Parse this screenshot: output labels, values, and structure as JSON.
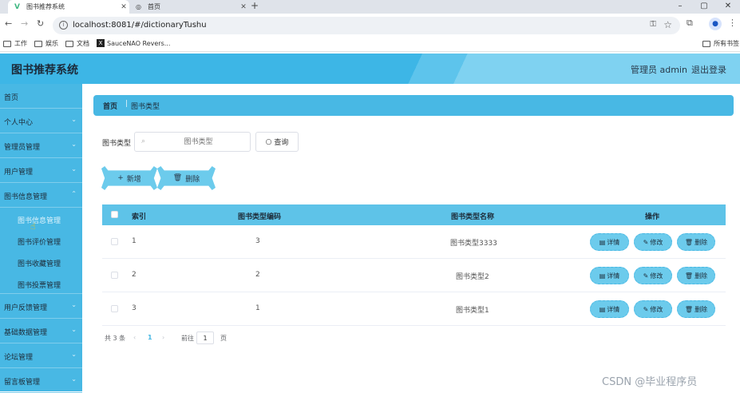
{
  "browser": {
    "tabs": [
      {
        "title": "图书推荐系统",
        "close": "✕"
      },
      {
        "title": "首页",
        "close": "✕"
      }
    ],
    "new_tab": "+",
    "url": "localhost:8081/#/dictionaryTushu",
    "bookmarks": [
      "工作",
      "娱乐",
      "文档",
      "SauceNAO Revers..."
    ],
    "bookmarks_right": "所有书签"
  },
  "header": {
    "title": "图书推荐系统",
    "admin_label": "管理员 admin",
    "logout": "退出登录"
  },
  "sidebar": {
    "items": [
      {
        "label": "首页",
        "chevron": false
      },
      {
        "label": "个人中心",
        "chevron": true
      },
      {
        "label": "管理员管理",
        "chevron": true
      },
      {
        "label": "用户管理",
        "chevron": true
      },
      {
        "label": "图书信息管理",
        "chevron": true
      }
    ],
    "subitems": [
      {
        "label": "图书信息管理",
        "active": true
      },
      {
        "label": "图书评价管理",
        "active": false
      },
      {
        "label": "图书收藏管理",
        "active": false
      },
      {
        "label": "图书投票管理",
        "active": false
      }
    ],
    "items_after": [
      {
        "label": "用户反馈管理"
      },
      {
        "label": "基础数据管理"
      },
      {
        "label": "论坛管理"
      },
      {
        "label": "留言板管理"
      }
    ]
  },
  "breadcrumb": {
    "home": "首页",
    "current": "图书类型"
  },
  "search": {
    "label": "图书类型",
    "placeholder": "图书类型",
    "query_button": "查询"
  },
  "actions": {
    "add": "新增",
    "delete": "删除"
  },
  "table": {
    "headers": [
      "索引",
      "图书类型编码",
      "图书类型名称",
      "操作"
    ],
    "rows": [
      {
        "index": "1",
        "code": "3",
        "name": "图书类型3333"
      },
      {
        "index": "2",
        "code": "2",
        "name": "图书类型2"
      },
      {
        "index": "3",
        "code": "1",
        "name": "图书类型1"
      }
    ],
    "row_actions": {
      "detail": "详情",
      "edit": "修改",
      "delete": "删除"
    }
  },
  "pagination": {
    "total": "共 3 条",
    "current_page": "1",
    "goto_prefix": "前往",
    "goto_value": "1",
    "goto_suffix": "页"
  },
  "watermark": "CSDN @毕业程序员",
  "colors": {
    "header": "#3db6e6",
    "sidebar": "#48b8e4",
    "table_head": "#5ec3e8",
    "button": "#6ccbec"
  }
}
